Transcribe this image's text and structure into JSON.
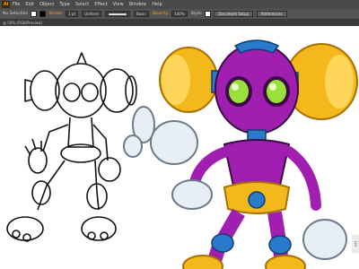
{
  "menubar": {
    "logo": "Ai",
    "items": [
      "File",
      "Edit",
      "Object",
      "Type",
      "Select",
      "Effect",
      "View",
      "Window",
      "Help"
    ]
  },
  "controlbar": {
    "no_selection": "No Selection",
    "stroke_label": "Stroke:",
    "stroke_weight": "1 pt",
    "stroke_profile": "Uniform",
    "brush": "Basic",
    "opacity_label": "Opacity:",
    "opacity_value": "100%",
    "style_label": "Style:",
    "document_setup": "Document Setup",
    "preferences": "Preferences"
  },
  "document": {
    "tab_title": "@ 50% (RGB/Preview)"
  },
  "canvas": {
    "side_tag": "Lin"
  },
  "colors": {
    "magenta": "#a01fb0",
    "gold": "#f2b81c",
    "green_eye": "#9be03a",
    "glove": "#e8eef5",
    "ui_dark": "#535353",
    "accent": "#ff9a1a"
  }
}
